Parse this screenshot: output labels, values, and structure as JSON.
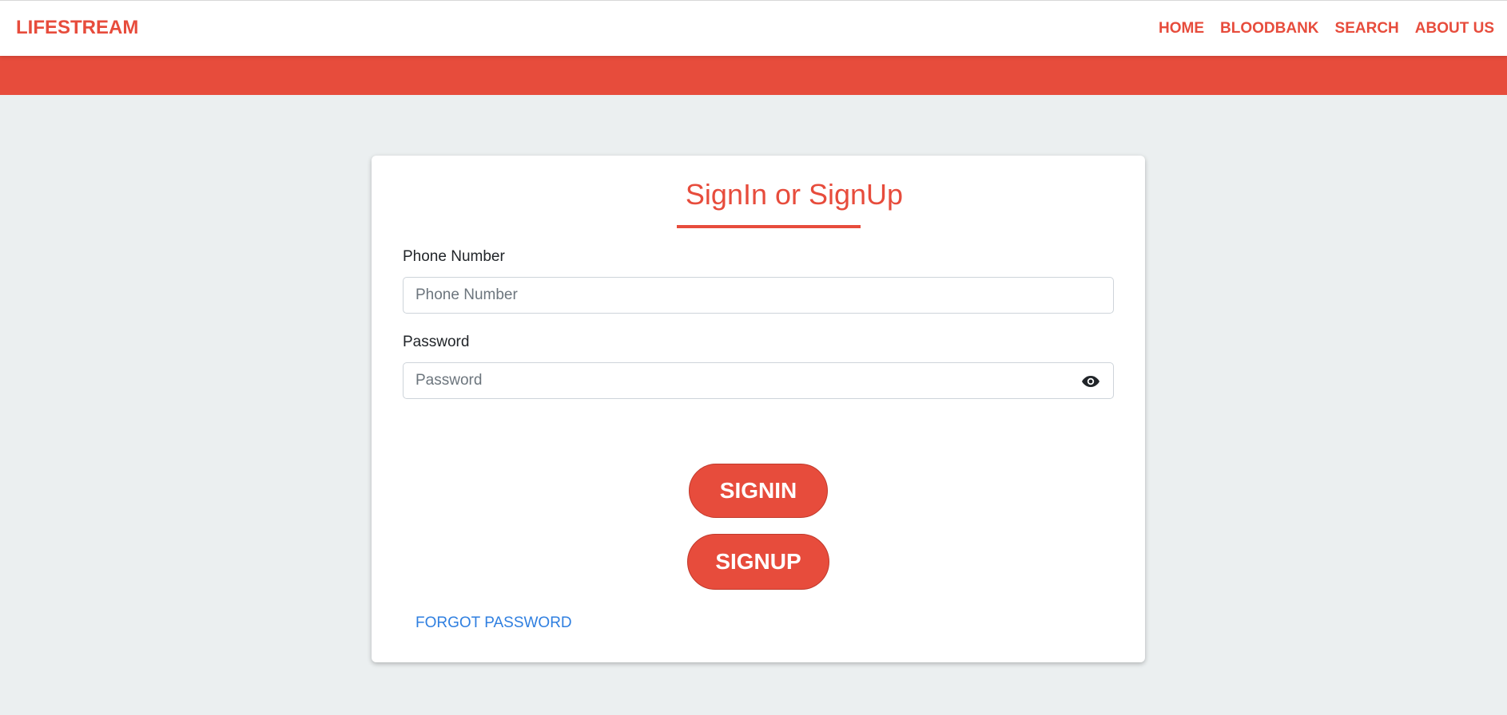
{
  "navbar": {
    "brand": "LIFESTREAM",
    "links": [
      "HOME",
      "BLOODBANK",
      "SEARCH",
      "ABOUT US"
    ]
  },
  "form": {
    "title": "SignIn or SignUp",
    "phone": {
      "label": "Phone Number",
      "placeholder": "Phone Number",
      "value": ""
    },
    "password": {
      "label": "Password",
      "placeholder": "Password",
      "value": "",
      "toggle_icon": "eye-icon"
    },
    "signin_label": "SIGNIN",
    "signup_label": "SIGNUP",
    "forgot_label": "FORGOT PASSWORD"
  },
  "colors": {
    "accent": "#e74c3c",
    "background": "#ebeff0",
    "link": "#2f7fe0"
  }
}
